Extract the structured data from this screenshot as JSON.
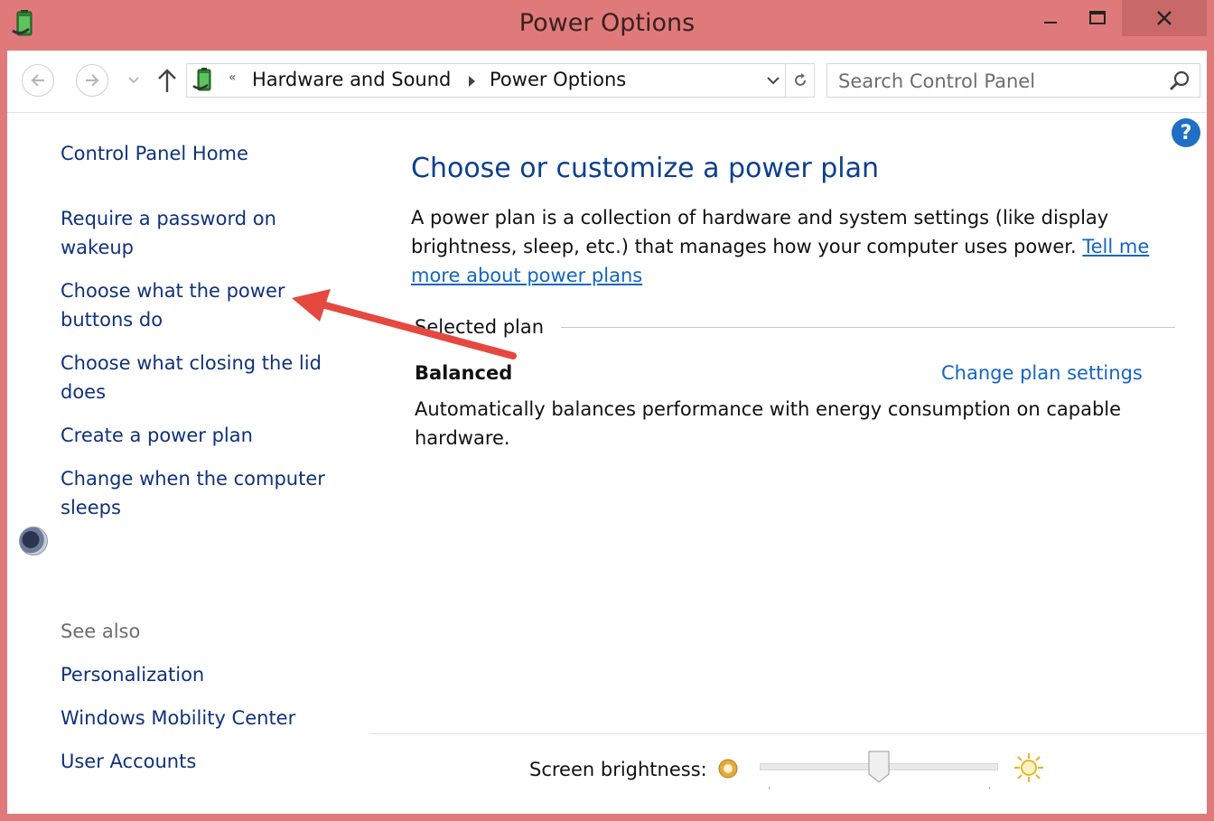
{
  "window": {
    "title": "Power Options",
    "controls": {
      "minimize": "minimize-icon",
      "maximize": "maximize-icon",
      "close": "close-icon"
    }
  },
  "nav": {
    "breadcrumb_overflow": "«",
    "breadcrumb": [
      "Hardware and Sound",
      "Power Options"
    ],
    "search_placeholder": "Search Control Panel"
  },
  "sidebar": {
    "home": "Control Panel Home",
    "tasks": [
      {
        "label": "Require a password on wakeup",
        "lines": [
          "Require a password on",
          "wakeup"
        ]
      },
      {
        "label": "Choose what the power buttons do",
        "lines": [
          "Choose what the power",
          "buttons do"
        ]
      },
      {
        "label": "Choose what closing the lid does",
        "lines": [
          "Choose what closing the lid",
          "does"
        ]
      },
      {
        "label": "Create a power plan",
        "lines": [
          "Create a power plan"
        ]
      },
      {
        "label": "Change when the computer sleeps",
        "lines": [
          "Change when the computer",
          "sleeps"
        ]
      }
    ],
    "see_also_heading": "See also",
    "see_also": [
      "Personalization",
      "Windows Mobility Center",
      "User Accounts"
    ]
  },
  "main": {
    "title": "Choose or customize a power plan",
    "description_line1": "A power plan is a collection of hardware and system settings (like display",
    "description_line2": "brightness, sleep, etc.) that manages how your computer uses power.",
    "tell_me_link": "Tell me",
    "tell_me_link_cont": "more about power plans",
    "selected_plan_heading": "Selected plan",
    "plan": {
      "name": "Balanced",
      "change_link": "Change plan settings",
      "description_line1": "Automatically balances performance with energy consumption on capable",
      "description_line2": "hardware."
    }
  },
  "brightness": {
    "label": "Screen brightness:",
    "level": 0.5
  },
  "annotation": {
    "color": "#e5483f"
  },
  "colors": {
    "frame": "#e07a7a",
    "link": "#1565c0",
    "heading": "#0d3f8e",
    "nav_text": "#10327a"
  }
}
